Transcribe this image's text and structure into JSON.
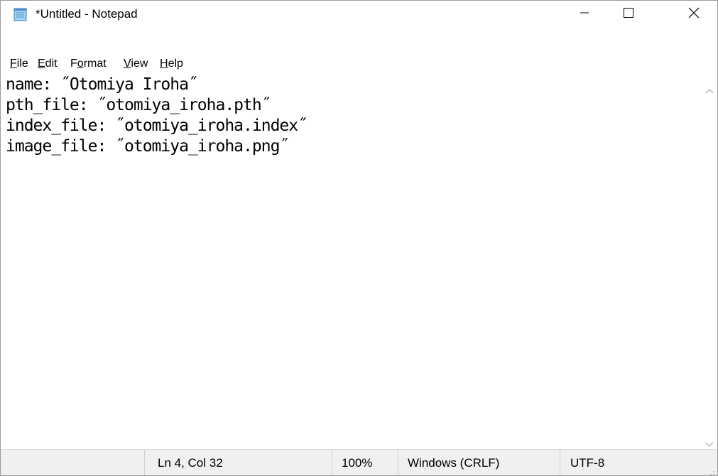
{
  "window": {
    "title": "*Untitled - Notepad",
    "icon": "notepad-icon"
  },
  "caption_buttons": {
    "minimize_icon": "minimize-icon",
    "maximize_icon": "maximize-icon",
    "close_icon": "close-icon"
  },
  "menu": [
    {
      "key": "F",
      "rest": "ile"
    },
    {
      "pre": "",
      "key": "E",
      "rest": "dit"
    },
    {
      "pre": "F",
      "key": "o",
      "rest": "rmat"
    },
    {
      "pre": "",
      "key": "V",
      "rest": "iew"
    },
    {
      "pre": "",
      "key": "H",
      "rest": "elp"
    }
  ],
  "editor": {
    "lines": [
      "name: ˝Otomiya Iroha˝",
      "pth_file: ˝otomiya_iroha.pth˝",
      "index_file: ˝otomiya_iroha.index˝",
      "image_file: ˝otomiya_iroha.png˝"
    ]
  },
  "status": {
    "position": "Ln 4, Col 32",
    "zoom": "100%",
    "line_ending": "Windows (CRLF)",
    "encoding": "UTF-8"
  },
  "colors": {
    "statusbar_bg": "#f0f0f0",
    "window_border": "#9b9b9b"
  }
}
